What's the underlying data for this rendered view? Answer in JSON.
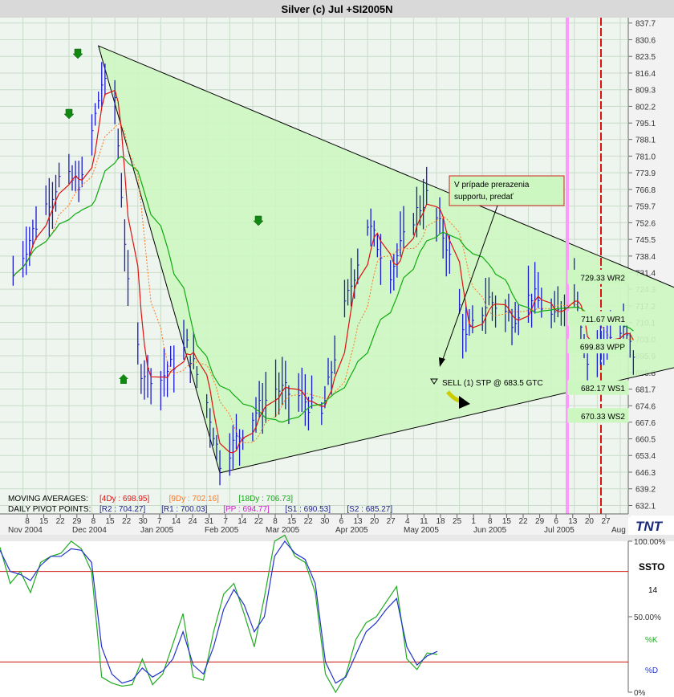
{
  "title": "Silver (c) Jul +SI2005N",
  "colors": {
    "title_bar": "#d9d9d9",
    "plot_bg": "#eef4ee",
    "grid": "#c9dcc9",
    "bars": "#1a1acc",
    "ma4": "#dd1111",
    "ma9": "#ff7722",
    "ma18": "#11aa11",
    "triangle_fill": "#ccf7c0",
    "pink_line": "#ff99ff",
    "red_line": "#dd1111",
    "ssto_k": "#22aa22",
    "ssto_d": "#2233cc",
    "ssto_level": "#cc1111",
    "arrow_down": "#118811",
    "sell_arrow": "#cccc00"
  },
  "chart_data": [
    {
      "type": "candlestick",
      "subtype": "hlc-bars",
      "instrument": "Silver (c) Jul +SI2005N",
      "y_axis_ticks": [
        "837.7",
        "830.6",
        "823.5",
        "816.4",
        "809.3",
        "802.2",
        "795.1",
        "788.1",
        "781.0",
        "773.9",
        "766.8",
        "759.7",
        "752.6",
        "745.5",
        "738.4",
        "731.4",
        "724.3",
        "717.2",
        "710.1",
        "703.0",
        "695.9",
        "688.8",
        "681.7",
        "674.6",
        "667.6",
        "660.5",
        "653.4",
        "646.3",
        "639.2",
        "632.1"
      ],
      "ylim": [
        628.5,
        840
      ],
      "x_tick_days": [
        "8",
        "15",
        "22",
        "29",
        "8",
        "15",
        "22",
        "30",
        "7",
        "14",
        "24",
        "31",
        "7",
        "14",
        "22",
        "8",
        "15",
        "22",
        "30",
        "6",
        "13",
        "20",
        "27",
        "4",
        "11",
        "18",
        "25",
        "1",
        "8",
        "15",
        "22",
        "29",
        "6",
        "13",
        "20",
        "27",
        "3"
      ],
      "x_month_labels": [
        "Nov 2004",
        "Dec 2004",
        "Jan 2005",
        "Feb 2005",
        "Mar 2005",
        "Apr 2005",
        "May 2005",
        "Jun 2005",
        "Jul 2005",
        "Aug"
      ],
      "price_series": [
        {
          "date": "2004-11-05",
          "value": 730
        },
        {
          "date": "2004-11-12",
          "value": 752
        },
        {
          "date": "2004-11-19",
          "value": 771
        },
        {
          "date": "2004-11-26",
          "value": 770
        },
        {
          "date": "2004-12-02",
          "value": 812
        },
        {
          "date": "2004-12-06",
          "value": 806
        },
        {
          "date": "2004-12-10",
          "value": 725
        },
        {
          "date": "2004-12-14",
          "value": 690
        },
        {
          "date": "2004-12-20",
          "value": 686
        },
        {
          "date": "2004-12-28",
          "value": 700
        },
        {
          "date": "2005-01-03",
          "value": 676
        },
        {
          "date": "2005-01-07",
          "value": 651
        },
        {
          "date": "2005-01-11",
          "value": 658
        },
        {
          "date": "2005-01-18",
          "value": 672
        },
        {
          "date": "2005-01-24",
          "value": 682
        },
        {
          "date": "2005-02-01",
          "value": 678
        },
        {
          "date": "2005-02-07",
          "value": 670
        },
        {
          "date": "2005-02-14",
          "value": 716
        },
        {
          "date": "2005-02-21",
          "value": 752
        },
        {
          "date": "2005-02-28",
          "value": 732
        },
        {
          "date": "2005-03-07",
          "value": 755
        },
        {
          "date": "2005-03-11",
          "value": 764
        },
        {
          "date": "2005-03-17",
          "value": 744
        },
        {
          "date": "2005-03-23",
          "value": 703
        },
        {
          "date": "2005-03-30",
          "value": 720
        },
        {
          "date": "2005-04-06",
          "value": 712
        },
        {
          "date": "2005-04-12",
          "value": 722
        },
        {
          "date": "2005-04-19",
          "value": 711
        },
        {
          "date": "2005-04-25",
          "value": 729
        },
        {
          "date": "2005-04-29",
          "value": 693
        },
        {
          "date": "2005-05-04",
          "value": 703
        },
        {
          "date": "2005-05-10",
          "value": 706
        },
        {
          "date": "2005-05-13",
          "value": 697
        }
      ],
      "moving_averages": {
        "label": "MOVING AVERAGES:",
        "items": [
          {
            "label": "[4Dy : 698.95]",
            "color": "#dd1111"
          },
          {
            "label": "[9Dy : 702.16]",
            "color": "#ff7722"
          },
          {
            "label": "[18Dy : 706.73]",
            "color": "#11aa11"
          }
        ]
      },
      "pivots": {
        "label": "DAILY PIVOT POINTS:",
        "items": [
          {
            "label": "[R2 : 704.27]",
            "color": "#222288"
          },
          {
            "label": "[R1 : 700.03]",
            "color": "#222288"
          },
          {
            "label": "[PP : 694.77]",
            "color": "#cc22cc"
          },
          {
            "label": "[S1 : 690.53]",
            "color": "#222288"
          },
          {
            "label": "[S2 : 685.27]",
            "color": "#222288"
          }
        ]
      },
      "pivot_boxes": [
        {
          "value": 729.33,
          "label": "729.33 WR2"
        },
        {
          "value": 711.67,
          "label": "711.67 WR1"
        },
        {
          "value": 699.83,
          "label": "699.83 WPP"
        },
        {
          "value": 682.17,
          "label": "682.17 WS1"
        },
        {
          "value": 670.33,
          "label": "670.33 WS2"
        }
      ],
      "triangle": [
        {
          "date": "2004-12-01",
          "value": 828
        },
        {
          "date": "2005-01-07",
          "value": 646
        },
        {
          "date": "2005-07-02",
          "value": 703
        }
      ],
      "annotation": {
        "text": "V prípade prerazenia supportu, predať",
        "lines": [
          "V prípade prerazenia",
          "supportu, predať"
        ]
      },
      "order_label": "SELL (1) STP @ 683.5 GTC",
      "logo": "TNT"
    },
    {
      "type": "line",
      "name": "SSTO",
      "ylim": [
        0,
        100
      ],
      "y_axis_ticks": [
        "100.00%",
        "50.00%",
        "0%"
      ],
      "side_labels": {
        "name": "SSTO",
        "period": "14",
        "k": "%K",
        "d": "%D"
      },
      "levels": [
        80,
        20
      ],
      "series": [
        {
          "name": "%K",
          "values": [
            96,
            72,
            80,
            66,
            86,
            90,
            92,
            100,
            95,
            80,
            10,
            6,
            4,
            5,
            22,
            5,
            12,
            32,
            52,
            10,
            8,
            40,
            65,
            72,
            52,
            30,
            63,
            100,
            108,
            90,
            86,
            66,
            12,
            0,
            11,
            35,
            46,
            50,
            60,
            70,
            22,
            15,
            26,
            25
          ]
        },
        {
          "name": "%D",
          "values": [
            94,
            80,
            78,
            74,
            84,
            90,
            90,
            95,
            94,
            86,
            30,
            12,
            6,
            8,
            16,
            10,
            14,
            22,
            40,
            18,
            12,
            30,
            55,
            68,
            58,
            40,
            50,
            90,
            100,
            92,
            88,
            72,
            20,
            6,
            10,
            25,
            40,
            46,
            55,
            62,
            30,
            18,
            24,
            27
          ]
        }
      ]
    }
  ]
}
